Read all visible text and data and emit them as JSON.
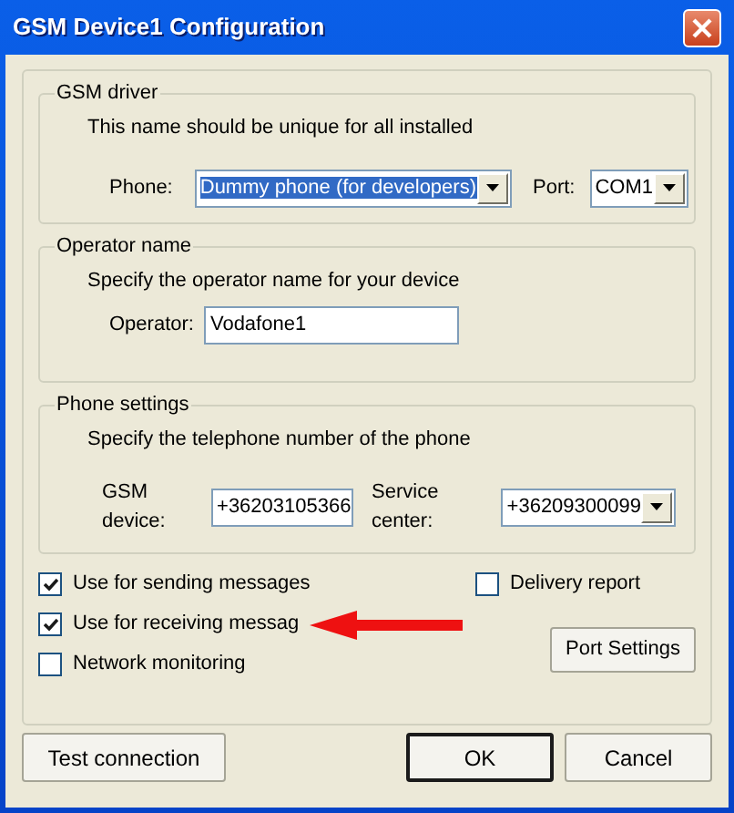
{
  "window": {
    "title": "GSM Device1 Configuration"
  },
  "gsm_driver": {
    "title": "GSM driver",
    "note": "This name should be unique for all installed",
    "phone_label": "Phone:",
    "phone_value": "Dummy phone (for developers)",
    "port_label": "Port:",
    "port_value": "COM1"
  },
  "operator": {
    "title": "Operator name",
    "note": "Specify the operator name for your device",
    "label": "Operator:",
    "value": "Vodafone1"
  },
  "phone_settings": {
    "title": "Phone settings",
    "note": "Specify the telephone number of the phone",
    "gsm_label": "GSM device:",
    "gsm_value": "+36203105366",
    "service_label": "Service center:",
    "service_value": "+36209300099"
  },
  "options_left": [
    {
      "label": "Use for sending messages",
      "checked": true
    },
    {
      "label": "Use for receiving messag",
      "checked": true
    },
    {
      "label": "Network monitoring",
      "checked": false
    }
  ],
  "options_right": [
    {
      "label": "Delivery report",
      "checked": false
    }
  ],
  "port_settings_button": "Port Settings",
  "buttons": [
    {
      "label": "Test connection",
      "default": false
    },
    {
      "label": "OK",
      "default": true
    },
    {
      "label": "Cancel",
      "default": false
    }
  ]
}
